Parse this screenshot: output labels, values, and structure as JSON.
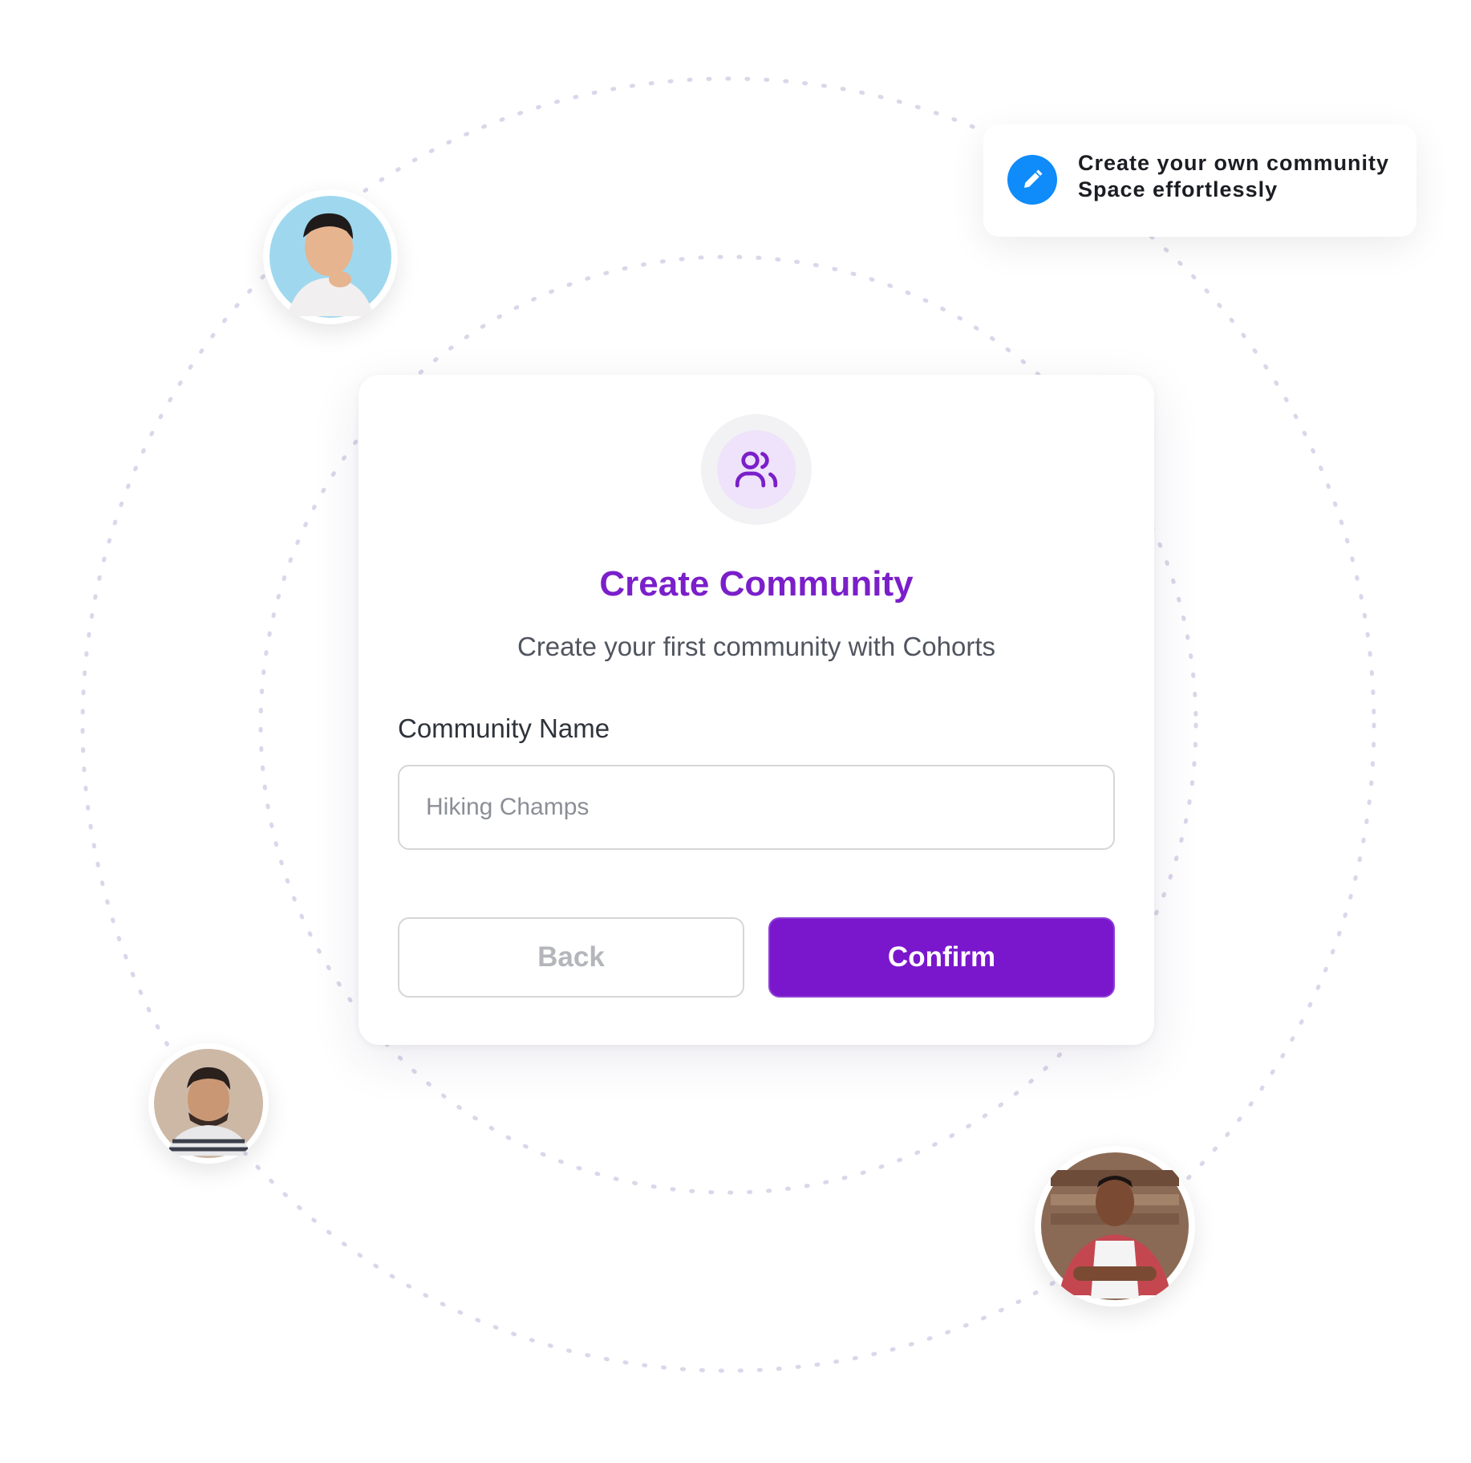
{
  "card": {
    "title": "Create Community",
    "subtitle": "Create your first community with Cohorts",
    "community_name_label": "Community Name",
    "community_name_placeholder": "Hiking Champs",
    "back_label": "Back",
    "confirm_label": "Confirm",
    "icon": "users-icon"
  },
  "toast": {
    "icon": "pencil-icon",
    "line1": "Create your own community",
    "line2": "Space effortlessly"
  },
  "avatars": [
    {
      "name": "avatar-man-blue-background",
      "bg": "#9fd8ee"
    },
    {
      "name": "avatar-man-beige-background",
      "bg": "#cdb8a6"
    },
    {
      "name": "avatar-man-red-shirt",
      "bg": "#8b6a55"
    }
  ],
  "colors": {
    "accent": "#7a17cc",
    "title": "#7a1fc9",
    "toast_icon": "#0f8bfa",
    "ring": "#dcd6ea"
  }
}
